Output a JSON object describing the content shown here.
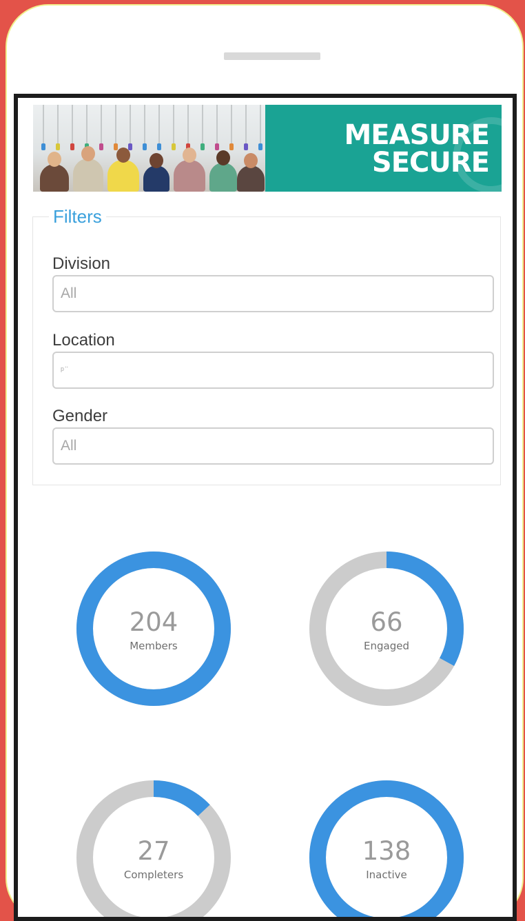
{
  "banner": {
    "brand_line1": "MEASURE",
    "brand_line2": "SECURE",
    "brand_color": "#1aa394"
  },
  "filters": {
    "title": "Filters",
    "fields": [
      {
        "label": "Division",
        "value": "All"
      },
      {
        "label": "Location",
        "value": "ᵖ ̈"
      },
      {
        "label": "Gender",
        "value": "All"
      }
    ]
  },
  "stats": [
    {
      "value": "204",
      "label": "Members",
      "fraction": 1.0
    },
    {
      "value": "66",
      "label": "Engaged",
      "fraction": 0.33
    },
    {
      "value": "27",
      "label": "Completers",
      "fraction": 0.13
    },
    {
      "value": "138",
      "label": "Inactive",
      "fraction": 1.0
    }
  ],
  "colors": {
    "accent": "#3b93e0",
    "track": "#cccccc",
    "frame": "#e35349"
  }
}
